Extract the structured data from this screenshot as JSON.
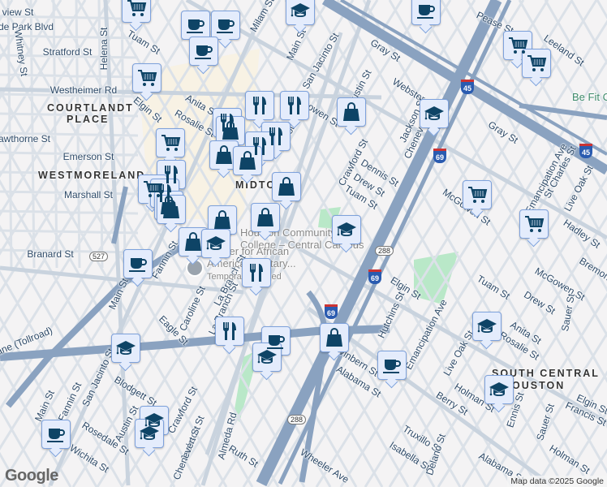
{
  "map": {
    "streets": [
      "view St",
      "de Park Blvd",
      "Whitney St",
      "Stratford St",
      "Helena St",
      "Tuam St",
      "Westheimer Rd",
      "Elgin St",
      "awthorne St",
      "Emerson St",
      "Marshall St",
      "Anita St",
      "Rosalie St",
      "Milam St",
      "Main St",
      "San Jacinto St",
      "McGowen St",
      "Austin St",
      "Caroline St",
      "Gray St",
      "Pease St",
      "Leeland St",
      "Webster St",
      "Jackson St",
      "Chenevert St",
      "Gray St",
      "Crawford St",
      "Dennis St",
      "Drew St",
      "Tuam St",
      "McGowen St",
      "Emancipation Ave",
      "St Charles St",
      "Live Oak St",
      "Hadley St",
      "Branard St",
      "Fannin St",
      "Main St",
      "Caroline St",
      "Eagle St",
      "La Branch St",
      "ane (Tollroad)",
      "San Jacinto St",
      "Blodgett St",
      "Main St",
      "Fannin St",
      "Rosedale St",
      "Austin St",
      "Wichita St",
      "Crawford St",
      "Jackson St",
      "Chenevert St",
      "Almeda Rd",
      "Ruth St",
      "Elgin St",
      "Hutchins St",
      "Emancipation Ave",
      "Tuam St",
      "Drew St",
      "McGowen St",
      "Anita St",
      "Rosalie St",
      "Live Oak St",
      "Winbern St",
      "Alabama St",
      "Holman St",
      "Berry St",
      "Ennis St",
      "Sauer St",
      "Francis St",
      "Elgin St",
      "Holman St",
      "Truxillo St",
      "Isabella St",
      "Delano St",
      "Wheeler Ave",
      "Alabama St",
      "Sauer St",
      "Bremond St",
      "La Branch St"
    ],
    "districts": [
      "COURTLANDT",
      "PLACE",
      "WESTMORELAND",
      "MIDTOWN",
      "SOUTH CENTRAL",
      "HOUSTON"
    ],
    "pois": {
      "college_line1": "Houston Community",
      "college_line2": "College – Central Campus",
      "museum_line1": "Center for African",
      "museum_line2": "American Military...",
      "museum_status": "Temporarily closed",
      "gym": "Be Fit C"
    },
    "route_shields": [
      "45",
      "45",
      "69",
      "69",
      "69"
    ],
    "route_markers": [
      "527",
      "288",
      "288"
    ],
    "marker_types": [
      "cafe-icon",
      "grocery-cart-icon",
      "school-icon",
      "restaurant-icon",
      "shopping-bag-icon"
    ],
    "logo": "Google",
    "attribution": "Map data ©2025 Google"
  }
}
